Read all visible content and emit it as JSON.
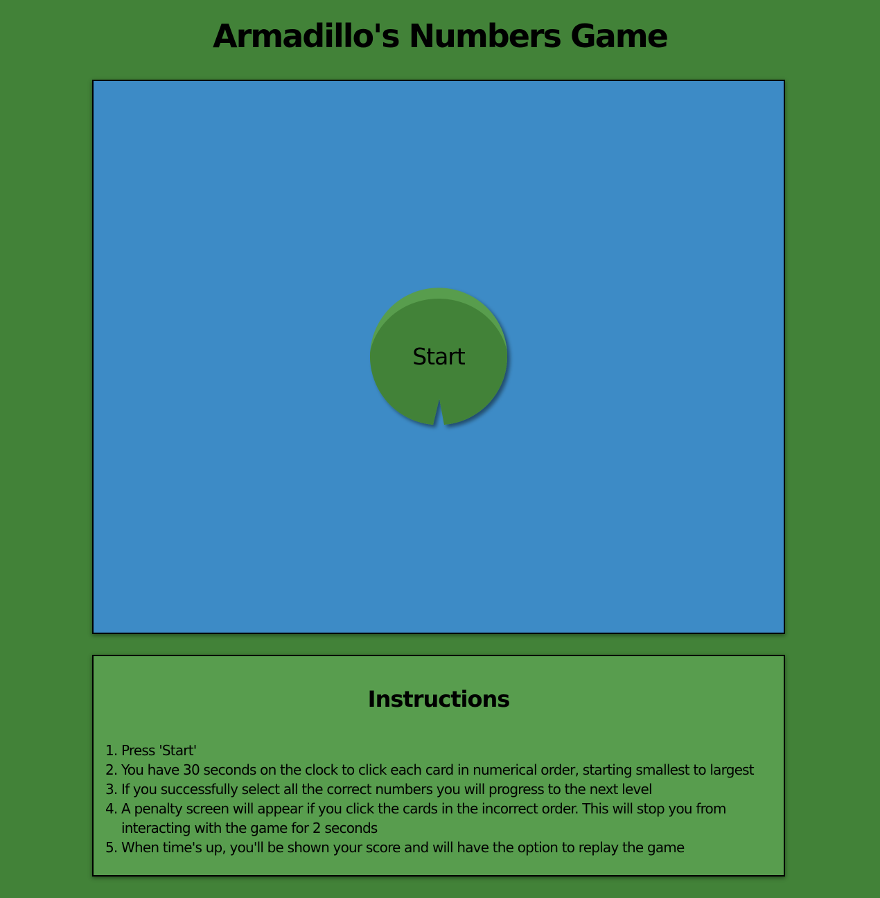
{
  "game": {
    "title": "Armadillo's Numbers Game",
    "start_label": "Start"
  },
  "instructions": {
    "title": "Instructions",
    "steps": [
      "Press 'Start'",
      "You have 30 seconds on the clock to click each card in numerical order, starting smallest to largest",
      "If you successfully select all the correct numbers you will progress to the next level",
      "A penalty screen will appear if you click the cards in the incorrect order. This will stop you from interacting with the game for 2 seconds",
      "When time's up, you'll be shown your score and will have the option to replay the game"
    ]
  },
  "colors": {
    "page_background": "#428238",
    "board_background": "#3d8bc6",
    "lilypad_dark": "#428238",
    "lilypad_light": "#589d4e",
    "instructions_background": "#589d4e"
  },
  "icons": {
    "start_button_shape": "lily-pad-icon"
  }
}
